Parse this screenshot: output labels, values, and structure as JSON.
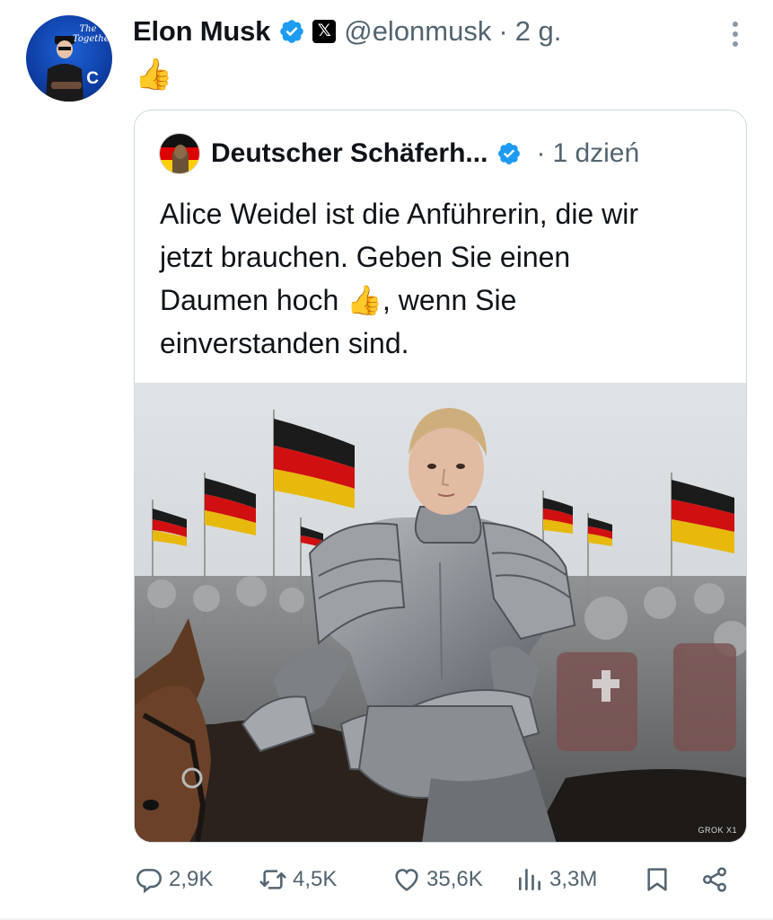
{
  "post": {
    "author_name": "Elon Musk",
    "handle": "@elonmusk",
    "separator": "·",
    "time": "2 g.",
    "text": "👍",
    "avatar_text": "The Together",
    "avatar_letter": "C"
  },
  "quoted_post": {
    "author_name": "Deutscher Schäferh...",
    "separator": "·",
    "time": "1 dzień",
    "text_lines": [
      "Alice Weidel ist die Anführerin, die wir",
      "jetzt brauchen. Geben Sie einen",
      "Daumen hoch 👍, wenn Sie",
      "einverstanden sind."
    ],
    "media_watermark": "GROK X1"
  },
  "actions": {
    "replies": "2,9K",
    "reposts": "4,5K",
    "likes": "35,6K",
    "views": "3,3M"
  },
  "colors": {
    "verified_blue": "#1d9bf0",
    "secondary_text": "#536471",
    "border": "#cfd9de"
  },
  "icons": [
    "verified-badge-icon",
    "x-logo-icon",
    "more-options-icon",
    "reply-icon",
    "repost-icon",
    "like-icon",
    "views-icon",
    "bookmark-icon",
    "share-icon"
  ]
}
